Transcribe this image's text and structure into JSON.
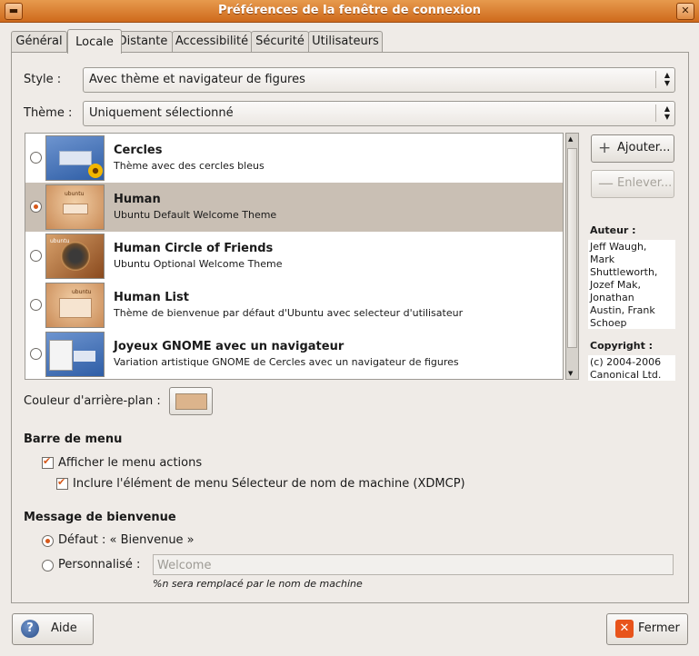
{
  "window": {
    "title": "Préférences de la fenêtre de connexion",
    "menu_icon": "window-menu-icon",
    "close_glyph": "✕"
  },
  "tabs": [
    {
      "label": "Général"
    },
    {
      "label": "Locale"
    },
    {
      "label": "Distante"
    },
    {
      "label": "Accessibilité"
    },
    {
      "label": "Sécurité"
    },
    {
      "label": "Utilisateurs"
    }
  ],
  "style": {
    "label": "Style :",
    "value": "Avec thème et navigateur de figures"
  },
  "theme": {
    "label": "Thème :",
    "value": "Uniquement sélectionné"
  },
  "themes": [
    {
      "name": "Cercles",
      "desc": "Thème avec des cercles bleus",
      "selected": false
    },
    {
      "name": "Human",
      "desc": "Ubuntu Default Welcome Theme",
      "selected": true
    },
    {
      "name": "Human Circle of Friends",
      "desc": "Ubuntu Optional Welcome Theme",
      "selected": false
    },
    {
      "name": "Human List",
      "desc": "Thème de bienvenue par défaut d'Ubuntu avec selecteur d'utilisateur",
      "selected": false
    },
    {
      "name": "Joyeux GNOME avec un navigateur",
      "desc": "Variation artistique GNOME de Cercles avec un navigateur de figures",
      "selected": false
    }
  ],
  "thumb_brand": "ubuntu",
  "buttons": {
    "add": "Ajouter...",
    "remove": "Enlever..."
  },
  "author": {
    "label": "Auteur :",
    "lines": [
      "Jeff Waugh,",
      "Mark",
      "Shuttleworth,",
      "Jozef Mak,",
      "Jonathan",
      "Austin, Frank",
      "Schoep"
    ]
  },
  "copyright": {
    "label": "Copyright :",
    "lines": [
      "(c) 2004-2006",
      "Canonical Ltd."
    ]
  },
  "background": {
    "label": "Couleur d'arrière-plan :",
    "color": "#dcb48c"
  },
  "menubar": {
    "title": "Barre de menu",
    "show_actions": {
      "label": "Afficher le menu actions",
      "checked": true
    },
    "include_chooser": {
      "label": "Inclure l'élément de menu Sélecteur de nom de machine (XDMCP)",
      "checked": true
    }
  },
  "welcome": {
    "title": "Message de bienvenue",
    "default": {
      "label": "Défaut : « Bienvenue »",
      "selected": true
    },
    "custom": {
      "label": "Personnalisé :",
      "selected": false,
      "value": "Welcome"
    },
    "hint": "%n sera remplacé par le nom de machine"
  },
  "footer": {
    "help": "Aide",
    "close": "Fermer"
  },
  "colors": {
    "title_bar": "#d97a2b",
    "selected_row": "#c9bfb4",
    "accent": "#d6581a"
  }
}
